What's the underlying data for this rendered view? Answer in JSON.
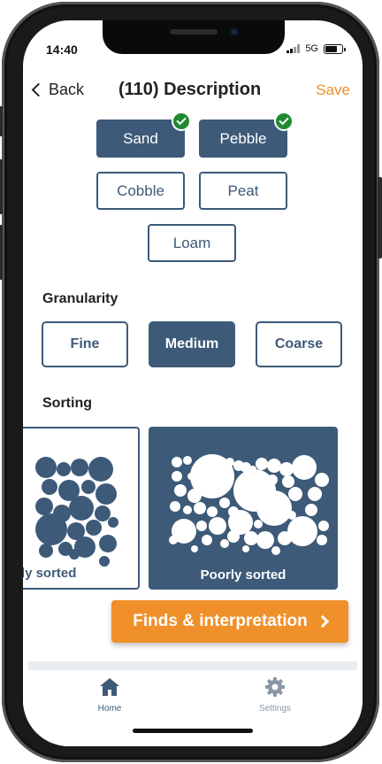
{
  "status": {
    "time": "14:40",
    "network": "5G"
  },
  "nav": {
    "back_label": "Back",
    "title": "(110) Description",
    "save_label": "Save"
  },
  "materials": [
    {
      "label": "Sand",
      "selected": true
    },
    {
      "label": "Pebble",
      "selected": true
    },
    {
      "label": "Cobble",
      "selected": false
    },
    {
      "label": "Peat",
      "selected": false
    },
    {
      "label": "Loam",
      "selected": false
    }
  ],
  "granularity": {
    "label": "Granularity",
    "options": [
      {
        "label": "Fine",
        "selected": false
      },
      {
        "label": "Medium",
        "selected": true
      },
      {
        "label": "Coarse",
        "selected": false
      }
    ]
  },
  "sorting": {
    "label": "Sorting",
    "options": [
      {
        "label": "ely sorted",
        "selected": false
      },
      {
        "label": "Poorly sorted",
        "selected": true
      }
    ]
  },
  "finds_button": {
    "label": "Finds & interpretation"
  },
  "tabbar": {
    "items": [
      {
        "label": "Home",
        "icon": "home-icon",
        "active": true
      },
      {
        "label": "Settings",
        "icon": "gear-icon",
        "active": false
      }
    ]
  },
  "colors": {
    "primary": "#3d5a78",
    "accent": "#f0902a",
    "check": "#1f8a32"
  }
}
